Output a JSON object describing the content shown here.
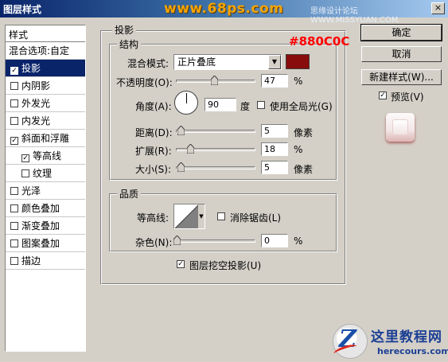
{
  "window": {
    "title": "图层样式",
    "close_glyph": "×",
    "watermark_site": "www.68ps.com",
    "watermark_forum": "思缘设计论坛 WWW.MISSYUAN.COM"
  },
  "styles_list": {
    "header": "样式",
    "blend_options": "混合选项:自定",
    "items": [
      {
        "label": "投影",
        "checked": true,
        "selected": true
      },
      {
        "label": "内阴影",
        "checked": false
      },
      {
        "label": "外发光",
        "checked": false
      },
      {
        "label": "内发光",
        "checked": false
      },
      {
        "label": "斜面和浮雕",
        "checked": true
      },
      {
        "label": "等高线",
        "checked": true,
        "sub": true
      },
      {
        "label": "纹理",
        "checked": false,
        "sub": true
      },
      {
        "label": "光泽",
        "checked": false
      },
      {
        "label": "颜色叠加",
        "checked": false
      },
      {
        "label": "渐变叠加",
        "checked": false
      },
      {
        "label": "图案叠加",
        "checked": false
      },
      {
        "label": "描边",
        "checked": false
      }
    ]
  },
  "drop_shadow": {
    "section_title": "投影",
    "structure": {
      "title": "结构",
      "blend_mode_label": "混合模式:",
      "blend_mode_value": "正片叠底",
      "shadow_color": "#880c0c",
      "color_annotation": "#880C0C",
      "opacity_label": "不透明度(O):",
      "opacity_value": "47",
      "opacity_fraction": 0.47,
      "opacity_unit": "%",
      "angle_label": "角度(A):",
      "angle_value": "90",
      "angle_unit": "度",
      "global_light_label": "使用全局光(G)",
      "global_light_checked": false,
      "distance_label": "距离(D):",
      "distance_value": "5",
      "distance_unit": "像素",
      "spread_label": "扩展(R):",
      "spread_value": "18",
      "spread_unit": "%",
      "size_label": "大小(S):",
      "size_value": "5",
      "size_unit": "像素"
    },
    "quality": {
      "title": "品质",
      "contour_label": "等高线:",
      "anti_alias_label": "消除锯齿(L)",
      "anti_alias_checked": false,
      "noise_label": "杂色(N):",
      "noise_value": "0",
      "noise_unit": "%"
    },
    "knockout_label": "图层挖空投影(U)",
    "knockout_checked": true
  },
  "buttons": {
    "ok": "确定",
    "cancel": "取消",
    "new_style": "新建样式(W)...",
    "preview_label": "预览(V)",
    "preview_checked": true
  },
  "logo": {
    "letter": "Z",
    "name": "这里教程网",
    "url": "herecours.com"
  }
}
